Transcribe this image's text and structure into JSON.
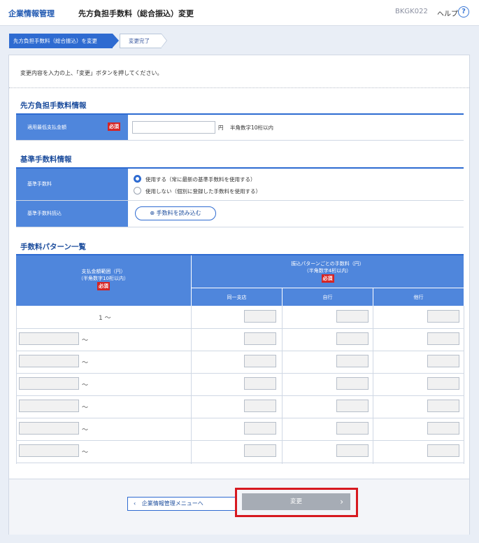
{
  "header": {
    "category": "企業情報管理",
    "title": "先方負担手数料（総合振込）変更",
    "screen_code": "BKGK022",
    "help_label": "ヘルプ",
    "help_icon_glyph": "?"
  },
  "steps": [
    {
      "label": "先方負担手数料（総合振込）を変更",
      "active": true
    },
    {
      "label": "変更完了",
      "active": false
    }
  ],
  "instruction": "変更内容を入力の上、「変更」ボタンを押してください。",
  "sections": {
    "fee_info": {
      "title": "先方負担手数料情報",
      "min_amount_label": "適用最低支払金額",
      "required_badge": "必須",
      "min_amount_value": "",
      "min_amount_unit": "円",
      "min_amount_note": "半角数字10桁以内"
    },
    "base_fee": {
      "title": "基準手数料情報",
      "base_fee_label": "基準手数料",
      "option_use": "使用する（常に最新の基準手数料を使用する）",
      "option_not_use": "使用しない（個別に登録した手数料を使用する）",
      "selected": "use",
      "load_label": "基準手数料読込",
      "load_button": "手数料を読み込む"
    },
    "pattern": {
      "title": "手数料パターン一覧",
      "col_range_header": "支払金額範囲（円）",
      "col_range_sub": "（半角数字10桁以内）",
      "col_fee_header": "振込パターンごとの手数料（円）",
      "col_fee_sub": "（半角数字4桁以内）",
      "required_badge": "必須",
      "sub_cols": [
        "同一支店",
        "自行",
        "他行"
      ],
      "first_row_start": "1",
      "tilde": "～"
    }
  },
  "footer": {
    "back_button": "企業情報管理メニューへ",
    "submit_button": "変更"
  },
  "colors": {
    "accent": "#2e6bd1",
    "header_cell": "#4f86dc",
    "required": "#d62424",
    "highlight_box": "#d71920"
  }
}
